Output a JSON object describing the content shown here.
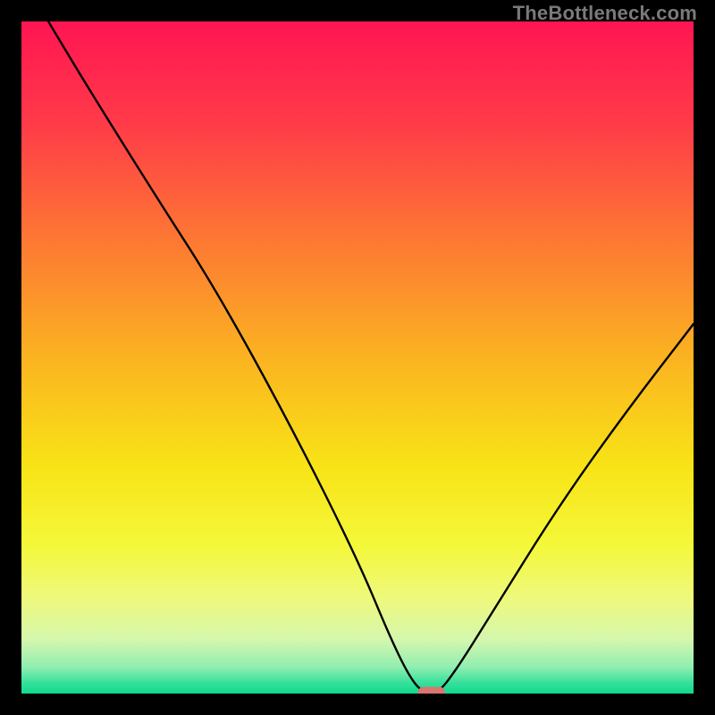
{
  "watermark": "TheBottleneck.com",
  "chart_data": {
    "type": "line",
    "title": "",
    "xlabel": "",
    "ylabel": "",
    "xlim": [
      0,
      100
    ],
    "ylim": [
      0,
      100
    ],
    "grid": false,
    "legend": false,
    "series": [
      {
        "name": "bottleneck-curve",
        "x": [
          4,
          10,
          20,
          29,
          40,
          50,
          55,
          58,
          60,
          62,
          65,
          70,
          80,
          90,
          100
        ],
        "values": [
          100,
          90,
          74,
          60,
          40,
          20,
          8,
          2,
          0,
          0,
          4,
          12,
          28,
          42,
          55
        ]
      }
    ],
    "marker": {
      "name": "optimum-marker",
      "x": 61,
      "y": 0,
      "color": "#d8766f",
      "shape": "pill"
    },
    "background": {
      "type": "vertical-gradient",
      "stops": [
        {
          "offset": 0.0,
          "color": "#ff1552"
        },
        {
          "offset": 0.15,
          "color": "#ff3a49"
        },
        {
          "offset": 0.32,
          "color": "#fd7634"
        },
        {
          "offset": 0.5,
          "color": "#fbb321"
        },
        {
          "offset": 0.66,
          "color": "#f8e316"
        },
        {
          "offset": 0.78,
          "color": "#f4f83a"
        },
        {
          "offset": 0.86,
          "color": "#eef97e"
        },
        {
          "offset": 0.92,
          "color": "#d4f7ad"
        },
        {
          "offset": 0.96,
          "color": "#93eeb1"
        },
        {
          "offset": 0.985,
          "color": "#33e09a"
        },
        {
          "offset": 1.0,
          "color": "#11d98f"
        }
      ]
    }
  }
}
